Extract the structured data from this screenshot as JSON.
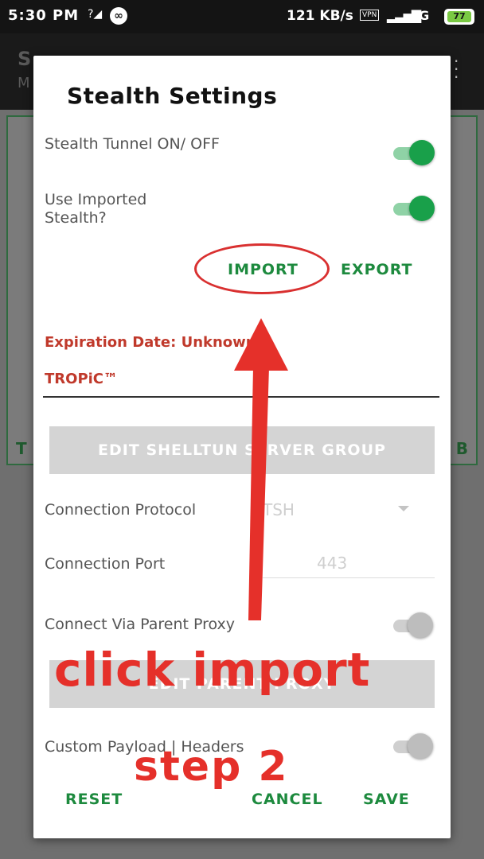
{
  "status_bar": {
    "time": "5:30 PM",
    "speed": "121 KB/s",
    "vpn": "VPN",
    "network": "4G",
    "battery": "77"
  },
  "dialog": {
    "title": "Stealth Settings",
    "stealth_tunnel_label": "Stealth Tunnel ON/ OFF",
    "stealth_tunnel_on": true,
    "use_imported_label": "Use Imported Stealth?",
    "use_imported_on": true,
    "import_label": "IMPORT",
    "export_label": "EXPORT",
    "expiration_label": "Expiration Date: Unknown",
    "tropic_label": "TROPiC™",
    "edit_server_group_label": "EDIT SHELLTUN SERVER GROUP",
    "connection_protocol_label": "Connection Protocol",
    "connection_protocol_value": "TSH",
    "connection_port_label": "Connection Port",
    "connection_port_value": "443",
    "parent_proxy_label": "Connect Via Parent Proxy",
    "parent_proxy_on": false,
    "edit_parent_proxy_label": "EDIT PARENT PROXY",
    "custom_payload_label": "Custom Payload | Headers",
    "custom_payload_on": false,
    "reset_label": "RESET",
    "cancel_label": "CANCEL",
    "save_label": "SAVE"
  },
  "annotations": {
    "instruction": "click import",
    "step": "step 2"
  },
  "colors": {
    "accent_green": "#1d8a3e",
    "toggle_green": "#19a04a",
    "annotation_red": "#e5302a",
    "expiration_red": "#c0392b"
  }
}
